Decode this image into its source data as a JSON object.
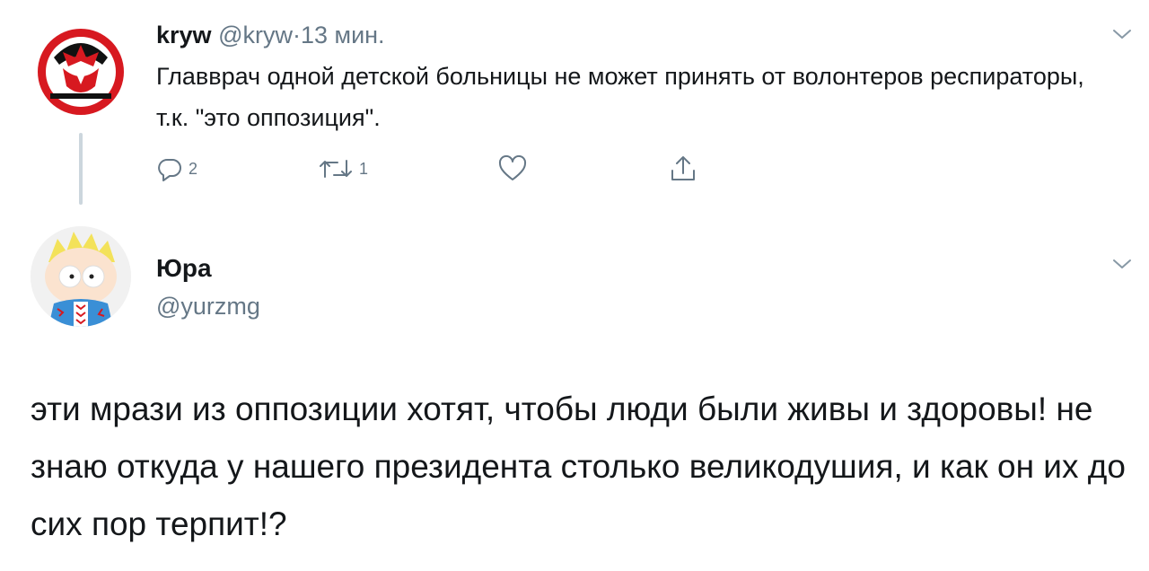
{
  "tweet1": {
    "display_name": "kryw",
    "handle": "@kryw",
    "separator": "·",
    "time": "13 мин.",
    "text": "Главврач одной детской больницы не может принять от волонтеров респираторы, т.к. \"это оппозиция\".",
    "actions": {
      "replies": "2",
      "retweets": "1"
    },
    "icons": {
      "reply": "speech-bubble-icon",
      "retweet": "retweet-icon",
      "like": "heart-icon",
      "share": "share-icon",
      "menu": "chevron-down-icon"
    }
  },
  "tweet2": {
    "display_name": "Юра",
    "handle": "@yurzmg",
    "text": "эти мрази из оппозиции хотят, чтобы люди были живы и здоровы! не знаю откуда у нашего президента столько великодушия, и как он их до сих пор терпит!?",
    "icons": {
      "menu": "chevron-down-icon"
    }
  },
  "colors": {
    "text": "#14171a",
    "muted": "#657786",
    "thread_line": "#ccd6dd",
    "emblem_red": "#d71920"
  }
}
